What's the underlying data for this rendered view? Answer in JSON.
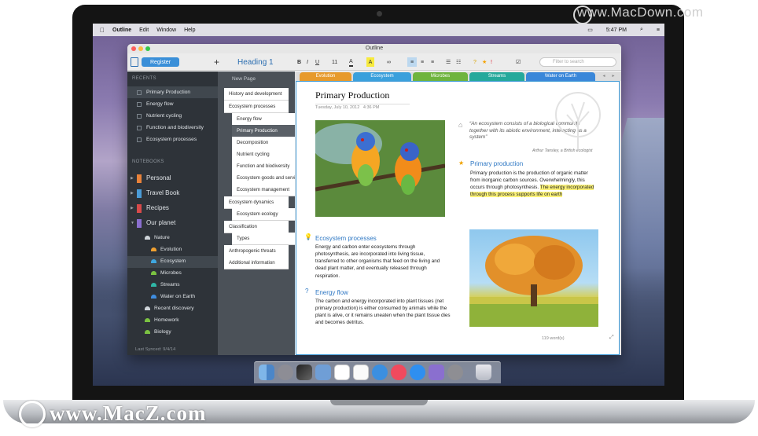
{
  "watermarks": {
    "top": "www.MacDown.com",
    "bottom": "www.MacZ.com"
  },
  "menubar": {
    "items": [
      "Outline",
      "Edit",
      "Window",
      "Help"
    ],
    "time": "5:47 PM"
  },
  "window": {
    "title": "Outline"
  },
  "toolbar": {
    "register": "Register",
    "heading": "Heading 1",
    "font_size": "11",
    "search_placeholder": "Filter to search"
  },
  "sidebar": {
    "recents_label": "RECENTS",
    "recents": [
      "Primary Production",
      "Energy flow",
      "Nutrient cycling",
      "Function and biodiversity",
      "Ecosystem processes"
    ],
    "notebooks_label": "NOTEBOOKS",
    "notebooks": [
      {
        "label": "Personal",
        "color": "#e8823a"
      },
      {
        "label": "Travel Book",
        "color": "#4a9bd6"
      },
      {
        "label": "Recipes",
        "color": "#d84a4a"
      },
      {
        "label": "Our planet",
        "color": "#8a6fcf"
      }
    ],
    "nature": "Nature",
    "sections": [
      {
        "label": "Evolution",
        "color": "#f0a030"
      },
      {
        "label": "Ecosystem",
        "color": "#3fa7e0"
      },
      {
        "label": "Microbes",
        "color": "#7bc242"
      },
      {
        "label": "Streams",
        "color": "#2fb7a7"
      },
      {
        "label": "Water on Earth",
        "color": "#3f8de0"
      }
    ],
    "recent_discovery": "Recent discovery",
    "homework": "Homework",
    "biology": "Biology",
    "last_synced": "Last Synced: 9/4/14"
  },
  "outline": {
    "new_page": "New Page",
    "pages": [
      "History and development",
      "Ecosystem processes",
      "Energy flow",
      "Primary Production",
      "Decomposition",
      "Nutrient cycling",
      "Function and biodiversity",
      "Ecosystem goods and services",
      "Ecosystem management",
      "Ecosystem dynamics",
      "Ecosystem ecology",
      "Classification",
      "Types",
      "Anthropogenic threats",
      "Additional information"
    ]
  },
  "tabs": [
    {
      "label": "Evolution",
      "color": "#e79a2c"
    },
    {
      "label": "Ecosystem",
      "color": "#3aa0dc"
    },
    {
      "label": "Microbes",
      "color": "#6fb43d"
    },
    {
      "label": "Streams",
      "color": "#25a99b"
    },
    {
      "label": "Water on Earth",
      "color": "#3a87d9"
    }
  ],
  "page": {
    "title": "Primary Production",
    "date": "Tuesday, July 10, 2012",
    "time": "4:36 PM",
    "quote": "“An ecosystem consists of a biological community together with its abiotic environment, interacting as a system”",
    "quote_author": "Arthur Tansley, a British ecologist",
    "h1": "Primary production",
    "p1a": "Primary production is the production of organic matter from inorganic carbon sources. Overwhelmingly, this occurs through photosynthesis. ",
    "p1b": "The energy incorporated through this process supports life on earth",
    "h2": "Ecosystem processes",
    "p2": "Energy and carbon enter ecosystems through photosynthesis, are incorporated into living tissue, transferred to other organisms that feed on the living and dead plant matter, and eventually released through respiration.",
    "h3": "Energy flow",
    "p3": "The carbon and energy incorporated into plant tissues (net primary production) is either consumed by animals while the plant is alive, or it remains uneaten when the plant tissue dies and becomes detritus.",
    "words": "119 word(s)"
  }
}
